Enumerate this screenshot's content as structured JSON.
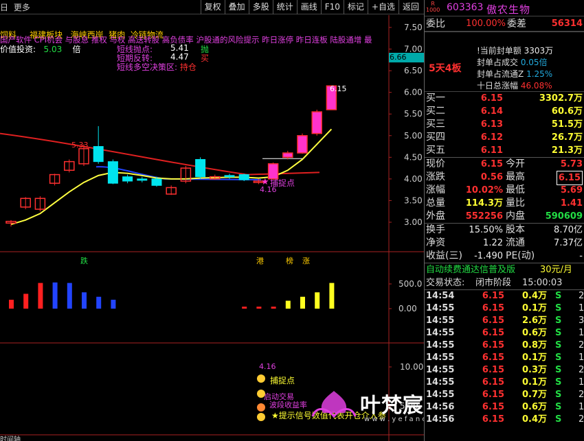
{
  "toolbar": {
    "left": [
      "日",
      "更多"
    ],
    "buttons": [
      "复权",
      "叠加",
      "多股",
      "统计",
      "画线",
      "F10",
      "标记",
      "+自选",
      "返回"
    ]
  },
  "overlay": {
    "line1": [
      "饲料",
      "福建板块",
      "海峡西岸",
      "猪肉",
      "冷链物流"
    ],
    "line2": "国产软件 CPI机会 与股息 推权 与权 高送转股 高负债率 沪股通的风险提示 昨日涨停 昨日连板 陆股通增 最",
    "value_invest_label": "价值投资:",
    "value_invest_val": "5.03",
    "value_invest_unit": "倍",
    "strategy": [
      {
        "label": "短线抛点:",
        "val": "5.41",
        "tag": "抛"
      },
      {
        "label": "短期反转:",
        "val": "4.47",
        "tag": "买"
      },
      {
        "label": "短线多空决策区:",
        "val": "",
        "tag": "持仓"
      }
    ],
    "price_tag": "6.66",
    "high_label": "6.15",
    "low_label": "4.16",
    "catch_label": "捕捉点",
    "peak_label": "5.33",
    "event_labels": [
      "跌",
      "港",
      "榜",
      "涨"
    ],
    "bottom_labels": [
      "4.16",
      "捕捉点",
      "启动交易",
      "波段收益率",
      "★提示信号数值代表开仓介入参"
    ],
    "bottom_axis_left": "时间轴",
    "watermark": "叶梵宸指标公式网",
    "watermark_url": "w w w . y e f a n c h e n . c o m"
  },
  "axis": {
    "price_ticks": [
      "7.50",
      "7.00",
      "6.50",
      "6.00",
      "5.50",
      "5.00",
      "4.50",
      "4.00",
      "3.50",
      "3.00"
    ],
    "vol_ticks": [
      "500.0",
      "0.00"
    ],
    "ind_ticks": [
      "10.00",
      "5.00"
    ]
  },
  "chart_data": {
    "type": "candlestick",
    "candles": [
      {
        "o": 2.98,
        "c": 3.02,
        "h": 3.05,
        "l": 2.9
      },
      {
        "o": 3.35,
        "c": 3.55,
        "h": 3.58,
        "l": 3.3
      },
      {
        "o": 3.3,
        "c": 3.55,
        "h": 3.6,
        "l": 3.25
      },
      {
        "o": 3.9,
        "c": 4.1,
        "h": 4.12,
        "l": 3.85
      },
      {
        "o": 4.2,
        "c": 4.4,
        "h": 4.45,
        "l": 4.15
      },
      {
        "o": 4.35,
        "c": 4.7,
        "h": 4.8,
        "l": 4.3
      },
      {
        "o": 4.75,
        "c": 4.4,
        "h": 5.22,
        "l": 4.35
      },
      {
        "o": 4.4,
        "c": 3.9,
        "h": 4.45,
        "l": 3.88
      },
      {
        "o": 4.05,
        "c": 3.95,
        "h": 4.1,
        "l": 3.9
      },
      {
        "o": 4.0,
        "c": 3.98,
        "h": 4.05,
        "l": 3.92
      },
      {
        "o": 4.0,
        "c": 3.85,
        "h": 4.05,
        "l": 3.82
      },
      {
        "o": 3.65,
        "c": 3.8,
        "h": 3.85,
        "l": 3.63
      },
      {
        "o": 3.95,
        "c": 4.25,
        "h": 4.3,
        "l": 3.9
      },
      {
        "o": 4.45,
        "c": 4.05,
        "h": 4.5,
        "l": 4.0
      },
      {
        "o": 4.0,
        "c": 4.05,
        "h": 4.1,
        "l": 3.98
      },
      {
        "o": 4.08,
        "c": 4.05,
        "h": 4.12,
        "l": 4.0
      },
      {
        "o": 4.1,
        "c": 3.98,
        "h": 4.12,
        "l": 3.95
      },
      {
        "o": 3.92,
        "c": 3.95,
        "h": 4.0,
        "l": 3.88
      },
      {
        "o": 4.0,
        "c": 4.35,
        "h": 4.38,
        "l": 3.98
      },
      {
        "o": 4.5,
        "c": 4.6,
        "h": 4.65,
        "l": 4.45
      },
      {
        "o": 4.6,
        "c": 5.0,
        "h": 5.05,
        "l": 4.58
      },
      {
        "o": 5.05,
        "c": 5.55,
        "h": 5.6,
        "l": 5.0
      },
      {
        "o": 5.6,
        "c": 6.15,
        "h": 6.15,
        "l": 5.6
      }
    ],
    "ma_yellow": [
      2.95,
      3.05,
      3.2,
      3.45,
      3.7,
      3.92,
      4.08,
      4.15,
      4.13,
      4.08,
      4.02,
      4.0,
      4.0,
      4.02,
      4.03,
      4.04,
      4.04,
      4.02,
      4.05,
      4.2,
      4.45,
      4.8,
      5.15
    ],
    "ma_red_start": 5.05,
    "ma_red_end": 4.15,
    "volume": [
      180,
      300,
      520,
      530,
      520,
      330,
      240,
      180,
      0,
      0,
      0,
      0,
      0,
      0,
      0,
      0,
      40,
      40,
      40,
      160,
      240,
      330,
      520
    ],
    "volume_colors": [
      "red",
      "red",
      "red",
      "blue",
      "blue",
      "blue",
      "blue",
      "blue",
      "none",
      "none",
      "none",
      "none",
      "none",
      "none",
      "none",
      "none",
      "red",
      "red",
      "red",
      "yellow",
      "yellow",
      "yellow",
      "yellow"
    ]
  },
  "panel": {
    "badge_r": "R",
    "badge_num": "1000",
    "code": "603363",
    "name": "傲农生物",
    "weibi_label": "委比",
    "weibi_val": "100.00%",
    "weicha_label": "委差",
    "weicha_val": "56314",
    "board_label": "5天4板",
    "board_rows": [
      {
        "label": "!当前封单额",
        "val": "3303万",
        "color": "white"
      },
      {
        "label": "封单占成交",
        "val": "0.05倍",
        "color": "cyan"
      },
      {
        "label": "封单占流通Z",
        "val": "1.25%",
        "color": "cyan"
      },
      {
        "label": "十日总涨幅",
        "val": "46.08%",
        "color": "red"
      }
    ],
    "bids": [
      {
        "label": "买一",
        "price": "6.15",
        "vol": "3302.7万"
      },
      {
        "label": "买二",
        "price": "6.14",
        "vol": "60.6万"
      },
      {
        "label": "买三",
        "price": "6.13",
        "vol": "51.5万"
      },
      {
        "label": "买四",
        "price": "6.12",
        "vol": "26.7万"
      },
      {
        "label": "买五",
        "price": "6.11",
        "vol": "21.3万"
      }
    ],
    "quote": [
      {
        "l1": "现价",
        "v1": "6.15",
        "c1": "red",
        "l2": "今开",
        "v2": "5.73",
        "c2": "red"
      },
      {
        "l1": "涨跌",
        "v1": "0.56",
        "c1": "red",
        "l2": "最高",
        "v2": "6.15",
        "c2": "redbox"
      },
      {
        "l1": "涨幅",
        "v1": "10.02%",
        "c1": "red",
        "l2": "最低",
        "v2": "5.69",
        "c2": "red"
      },
      {
        "l1": "总量",
        "v1": "114.3万",
        "c1": "yellow",
        "l2": "量比",
        "v2": "1.41",
        "c2": "red"
      },
      {
        "l1": "外盘",
        "v1": "552256",
        "c1": "red",
        "l2": "内盘",
        "v2": "590609",
        "c2": "green"
      }
    ],
    "quote2": [
      {
        "l1": "换手",
        "v1": "15.50%",
        "l2": "股本",
        "v2": "8.70亿"
      },
      {
        "l1": "净资",
        "v1": "1.22",
        "l2": "流通",
        "v2": "7.37亿"
      },
      {
        "l1": "收益(三)",
        "v1": "-1.490",
        "l2": "PE(动)",
        "v2": "-"
      }
    ],
    "promo": "自动续费通达信普及版",
    "promo_price": "30元/月",
    "status_label": "交易状态:",
    "status_val": "闭市阶段",
    "status_time": "15:00:03",
    "ticks": [
      {
        "t": "14:54",
        "p": "6.15",
        "v": "0.4万",
        "s": "S",
        "n": "2"
      },
      {
        "t": "14:55",
        "p": "6.15",
        "v": "0.1万",
        "s": "S",
        "n": "1"
      },
      {
        "t": "14:55",
        "p": "6.15",
        "v": "2.6万",
        "s": "S",
        "n": "3"
      },
      {
        "t": "14:55",
        "p": "6.15",
        "v": "0.6万",
        "s": "S",
        "n": "1"
      },
      {
        "t": "14:55",
        "p": "6.15",
        "v": "0.8万",
        "s": "S",
        "n": "2"
      },
      {
        "t": "14:55",
        "p": "6.15",
        "v": "0.1万",
        "s": "S",
        "n": "1"
      },
      {
        "t": "14:55",
        "p": "6.15",
        "v": "0.3万",
        "s": "S",
        "n": "2"
      },
      {
        "t": "14:55",
        "p": "6.15",
        "v": "0.1万",
        "s": "S",
        "n": "1"
      },
      {
        "t": "14:55",
        "p": "6.15",
        "v": "0.7万",
        "s": "S",
        "n": "2"
      },
      {
        "t": "14:56",
        "p": "6.15",
        "v": "0.6万",
        "s": "S",
        "n": "1"
      },
      {
        "t": "14:56",
        "p": "6.15",
        "v": "0.4万",
        "s": "S",
        "n": "2"
      }
    ]
  }
}
